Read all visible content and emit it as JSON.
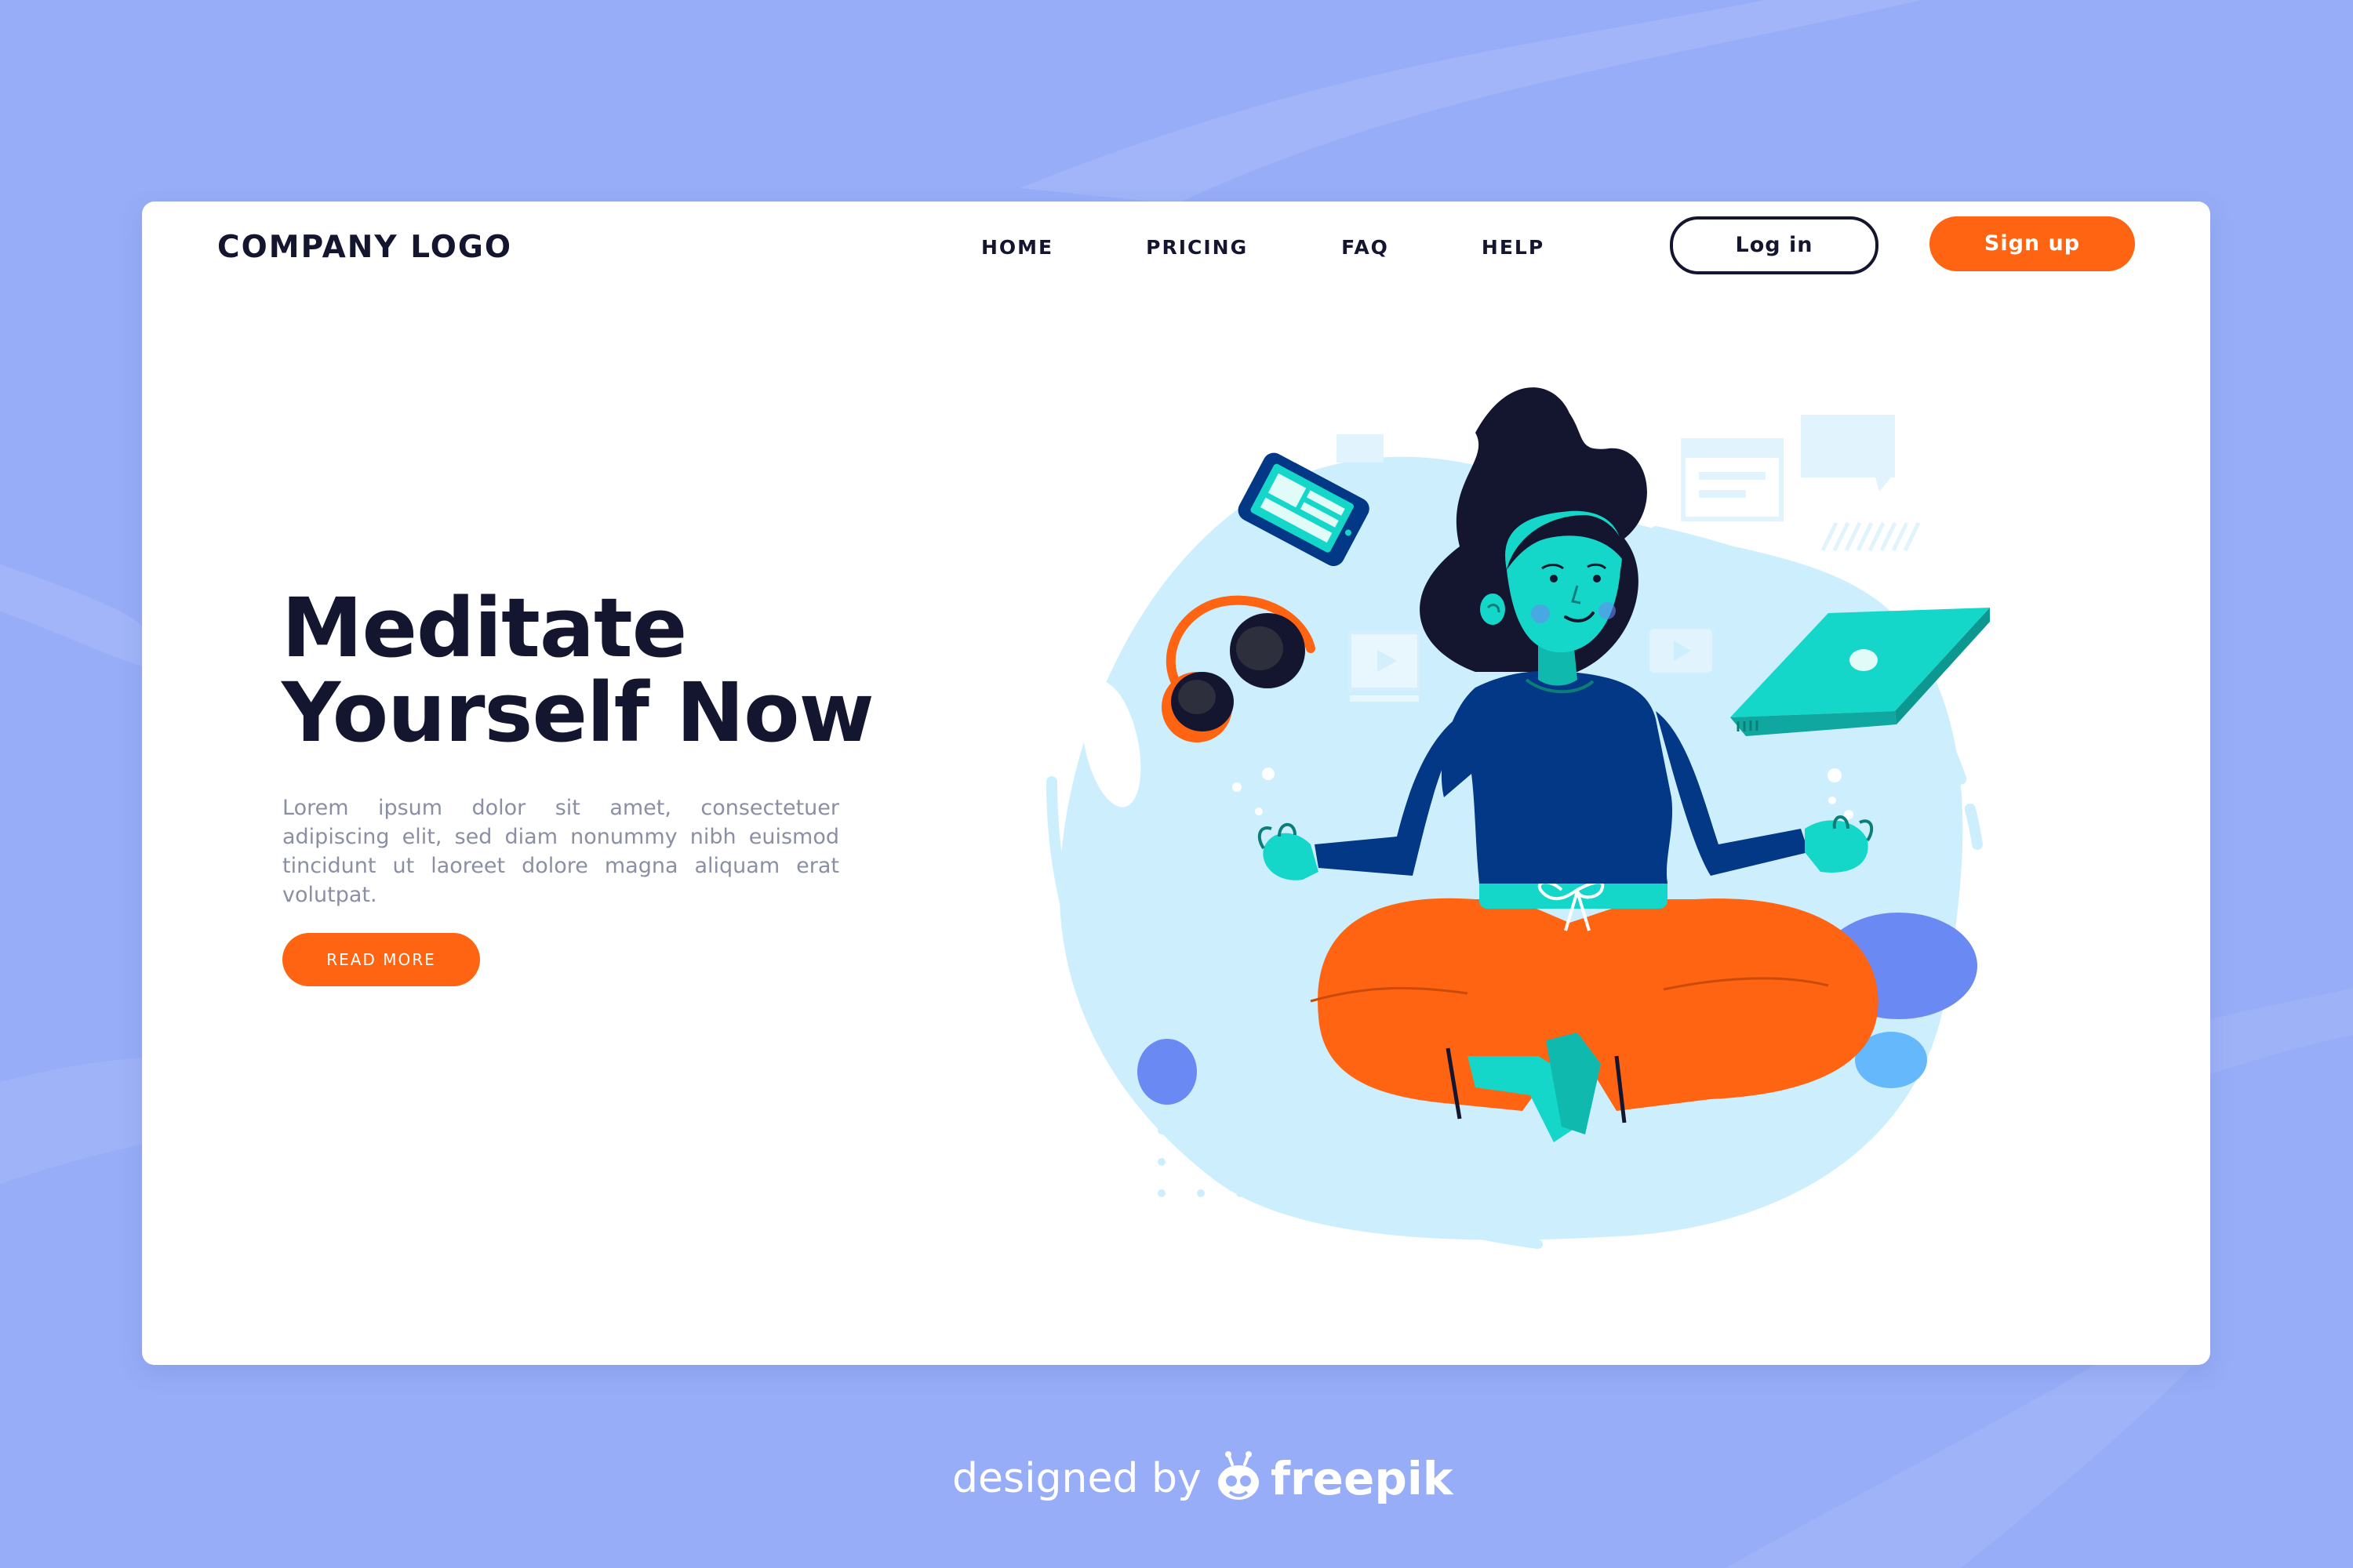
{
  "header": {
    "logo": "COMPANY LOGO",
    "nav": [
      {
        "label": "HOME"
      },
      {
        "label": "PRICING"
      },
      {
        "label": "FAQ"
      },
      {
        "label": "HELP"
      }
    ],
    "login_label": "Log in",
    "signup_label": "Sign up"
  },
  "hero": {
    "title_line1": "Meditate",
    "title_line2": "Yourself Now",
    "body": "Lorem ipsum dolor sit amet, consectetuer adipiscing elit, sed diam nonummy nibh euismod tincidunt ut laoreet dolore magna aliquam erat volutpat.",
    "cta_label": "READ MORE"
  },
  "credit": {
    "prefix": "designed by",
    "brand": "freepik"
  },
  "colors": {
    "background": "#97adf7",
    "card": "#ffffff",
    "text_dark": "#13162e",
    "text_muted": "#8a8fa4",
    "accent_orange": "#fe6411",
    "skin_teal": "#14d6c9",
    "sweater_navy": "#023886",
    "blob_light_blue": "#cdeffd",
    "hair": "#13162e"
  },
  "illustration": {
    "subject": "woman meditating in lotus pose",
    "items": [
      "smartphone-icon",
      "headphones-icon",
      "laptop-icon",
      "video-frame-icon",
      "chat-bubble-icon",
      "play-icon"
    ]
  }
}
